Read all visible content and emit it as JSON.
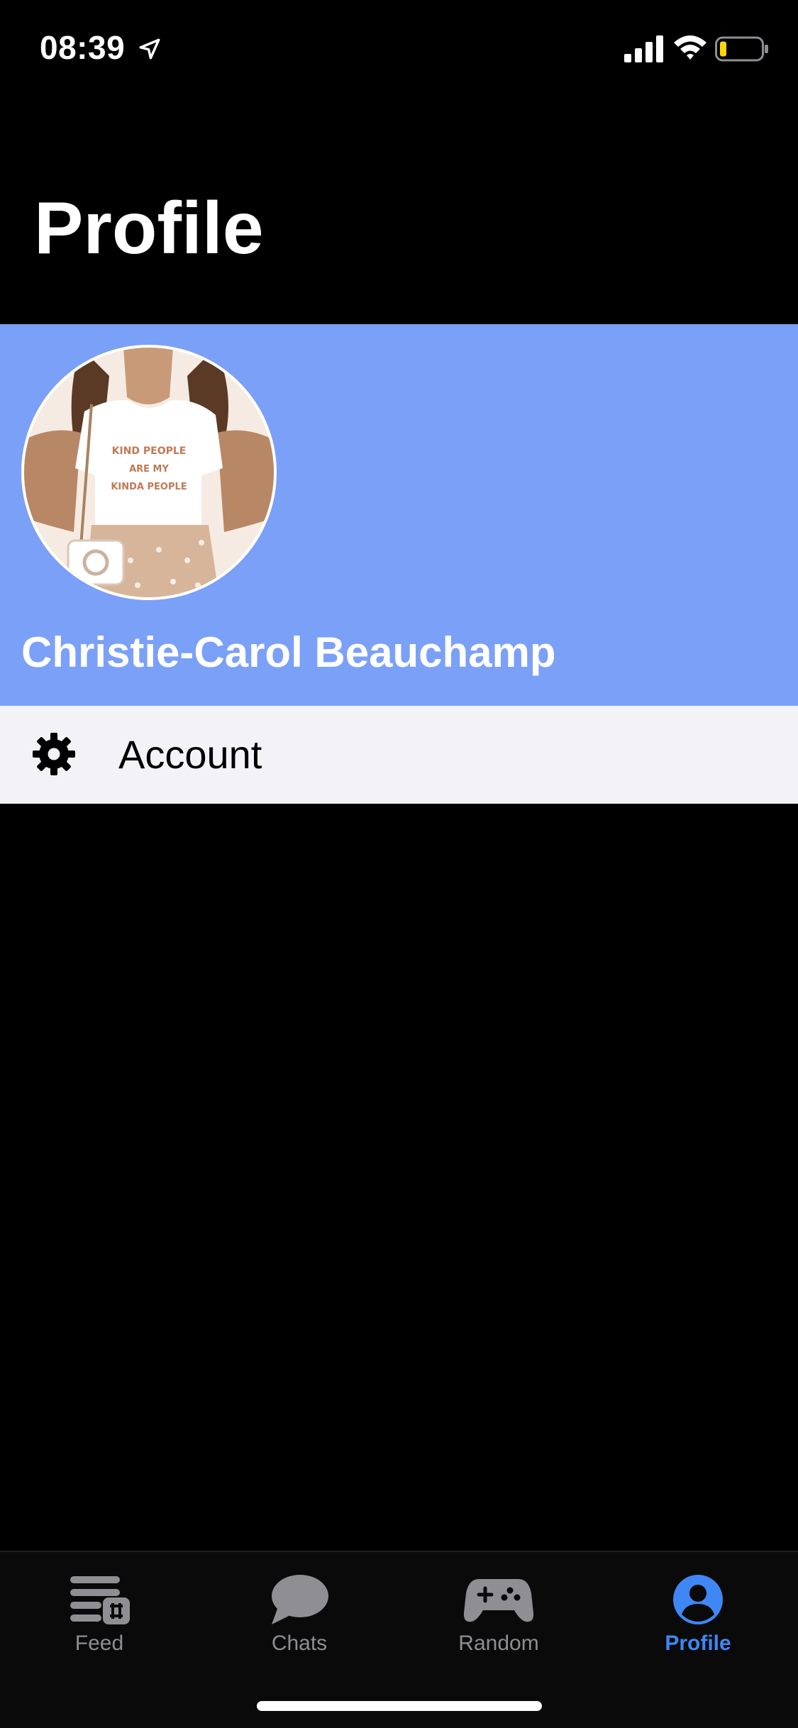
{
  "status_bar": {
    "time": "08:39"
  },
  "page": {
    "title": "Profile"
  },
  "profile": {
    "name": "Christie-Carol Beauchamp",
    "avatar_shirt_text": [
      "KIND PEOPLE",
      "ARE MY",
      "KINDA PEOPLE"
    ]
  },
  "menu": {
    "account_label": "Account"
  },
  "tab_bar": {
    "tabs": [
      {
        "label": "Feed",
        "icon": "feed-icon"
      },
      {
        "label": "Chats",
        "icon": "chat-bubble-icon"
      },
      {
        "label": "Random",
        "icon": "gamepad-icon"
      },
      {
        "label": "Profile",
        "icon": "person-circle-icon"
      }
    ],
    "active_tab": "Profile"
  },
  "colors": {
    "background": "#000000",
    "profile_header": "#7ba0f7",
    "account_row": "#f2f2f7",
    "tab_active": "#3f87f5",
    "tab_inactive": "#8e8e93"
  }
}
